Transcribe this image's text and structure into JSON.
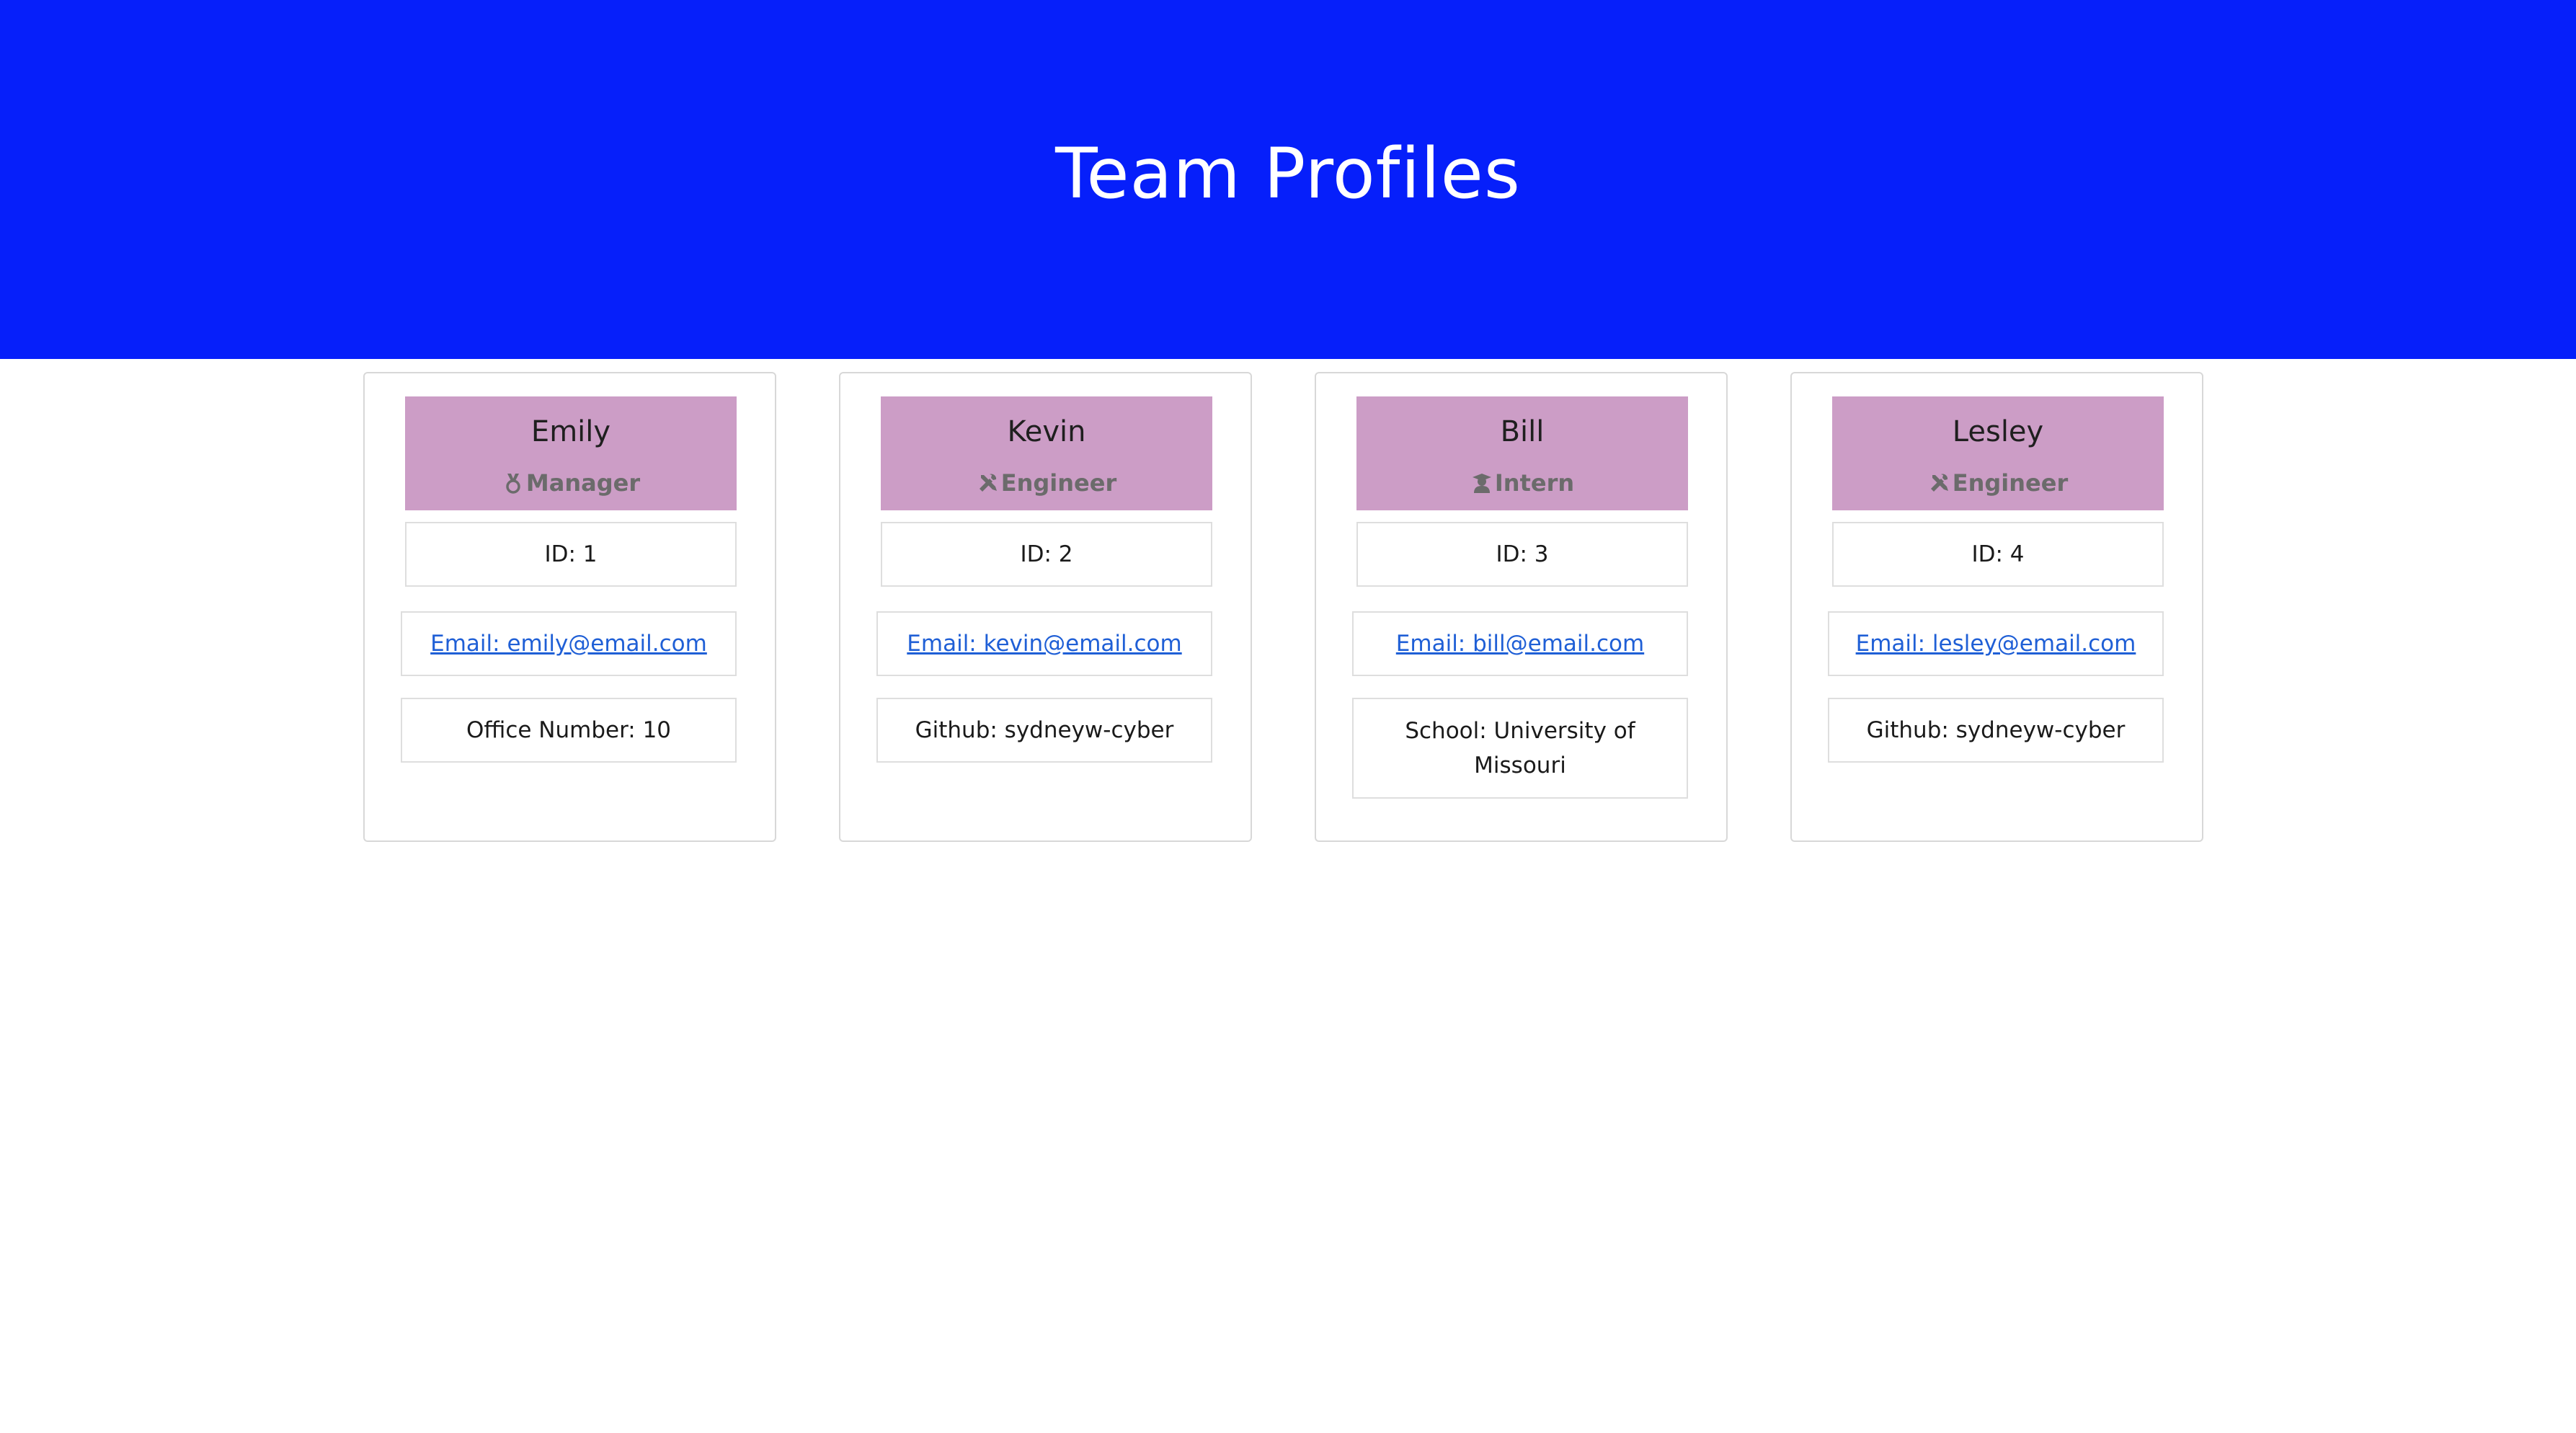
{
  "header": {
    "title": "Team Profiles",
    "background_color": "#061ffa"
  },
  "colors": {
    "card_header": "#cc9dc6",
    "link": "#1f5fd6"
  },
  "team": [
    {
      "name": "Emily",
      "role": "Manager",
      "role_icon": "medal-icon",
      "id_text": "ID: 1",
      "email_text": "Email: emily@email.com",
      "extra_text": "Office Number: 10"
    },
    {
      "name": "Kevin",
      "role": "Engineer",
      "role_icon": "tools-icon",
      "id_text": "ID: 2",
      "email_text": "Email: kevin@email.com",
      "extra_text": "Github: sydneyw-cyber"
    },
    {
      "name": "Bill",
      "role": "Intern",
      "role_icon": "graduate-icon",
      "id_text": "ID: 3",
      "email_text": "Email: bill@email.com",
      "extra_text": "School: University of Missouri"
    },
    {
      "name": "Lesley",
      "role": "Engineer",
      "role_icon": "tools-icon",
      "id_text": "ID: 4",
      "email_text": "Email: lesley@email.com",
      "extra_text": "Github: sydneyw-cyber"
    }
  ]
}
